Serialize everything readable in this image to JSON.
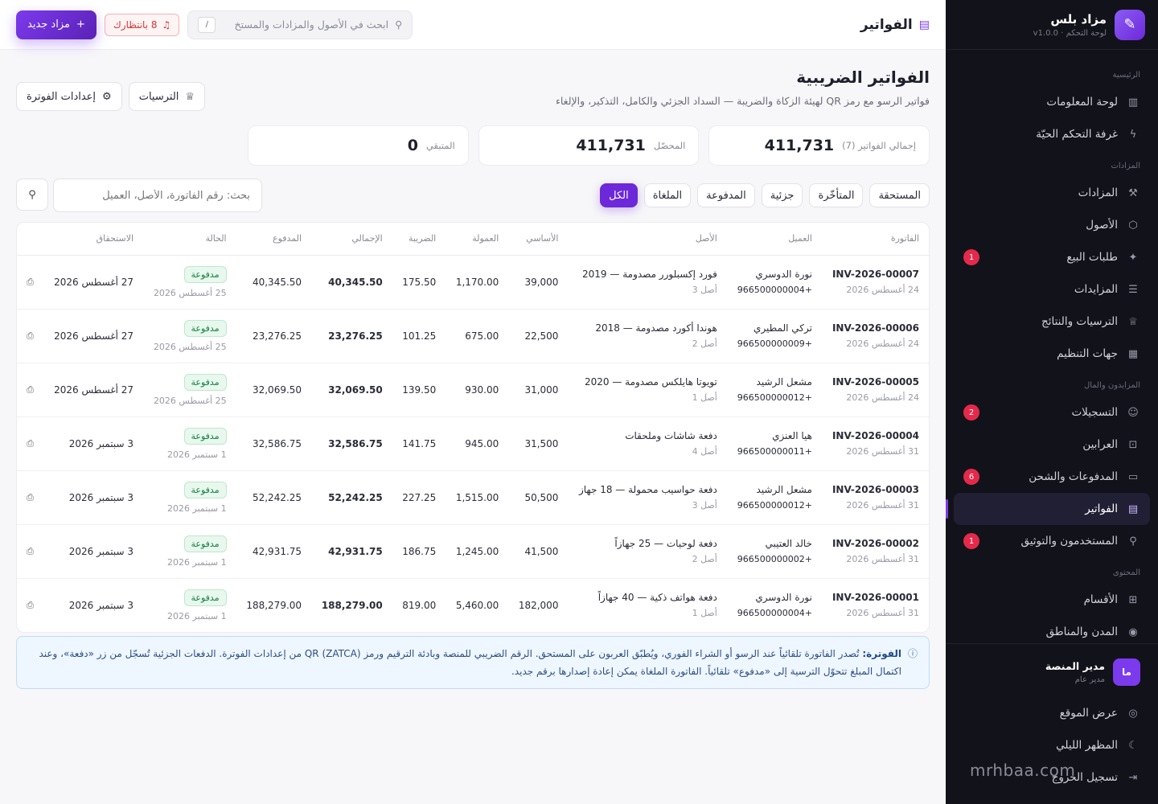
{
  "brand": {
    "name": "مزاد بلس",
    "sub": "لوحة التحكم · v1.0.0"
  },
  "nav": [
    {
      "type": "section",
      "label": "الرئيسية"
    },
    {
      "type": "item",
      "key": "info-panel",
      "label": "لوحة المعلومات",
      "icon": "chart-icon",
      "glyph": "▥"
    },
    {
      "type": "item",
      "key": "live-room",
      "label": "غرفة التحكم الحيّة",
      "icon": "bolt-icon",
      "glyph": "ϟ"
    },
    {
      "type": "section",
      "label": "المزادات"
    },
    {
      "type": "item",
      "key": "auctions",
      "label": "المزادات",
      "icon": "gavel-icon",
      "glyph": "⚒"
    },
    {
      "type": "item",
      "key": "assets",
      "label": "الأصول",
      "icon": "cube-icon",
      "glyph": "⬡"
    },
    {
      "type": "item",
      "key": "sell-requests",
      "label": "طلبات البيع",
      "icon": "sparkle-icon",
      "glyph": "✦",
      "badge": "1"
    },
    {
      "type": "item",
      "key": "bids",
      "label": "المزايدات",
      "icon": "list-icon",
      "glyph": "☰"
    },
    {
      "type": "item",
      "key": "awards",
      "label": "الترسيات والنتائج",
      "icon": "trophy-icon",
      "glyph": "♕"
    },
    {
      "type": "item",
      "key": "orgs",
      "label": "جهات التنظيم",
      "icon": "building-icon",
      "glyph": "▦"
    },
    {
      "type": "section",
      "label": "المزايدون والمال"
    },
    {
      "type": "item",
      "key": "registrations",
      "label": "التسجيلات",
      "icon": "user-icon",
      "glyph": "☺",
      "badge": "2"
    },
    {
      "type": "item",
      "key": "deposits",
      "label": "العرابين",
      "icon": "lock-icon",
      "glyph": "⊡"
    },
    {
      "type": "item",
      "key": "payments",
      "label": "المدفوعات والشحن",
      "icon": "card-icon",
      "glyph": "▭",
      "badge": "6"
    },
    {
      "type": "item",
      "key": "invoices",
      "label": "الفواتير",
      "icon": "invoice-icon",
      "glyph": "▤",
      "active": true
    },
    {
      "type": "item",
      "key": "users",
      "label": "المستخدمون والتوثيق",
      "icon": "person-icon",
      "glyph": "⚲",
      "badge": "1"
    },
    {
      "type": "section",
      "label": "المحتوى"
    },
    {
      "type": "item",
      "key": "categories",
      "label": "الأقسام",
      "icon": "grid-icon",
      "glyph": "⊞"
    },
    {
      "type": "item",
      "key": "cities",
      "label": "المدن والمناطق",
      "icon": "pin-icon",
      "glyph": "◉"
    }
  ],
  "user": {
    "avatar": "ما",
    "name": "مدير المنصة",
    "role": "مدير عام"
  },
  "bottom_nav": [
    {
      "key": "view-site",
      "label": "عرض الموقع",
      "icon": "eye-icon",
      "glyph": "◎"
    },
    {
      "key": "dark-mode",
      "label": "المظهر الليلي",
      "icon": "moon-icon",
      "glyph": "☾"
    },
    {
      "key": "logout",
      "label": "تسجيل الخروج",
      "icon": "logout-icon",
      "glyph": "⇥"
    }
  ],
  "watermark": "mrhbaa.com",
  "topbar": {
    "title": "الفواتير",
    "search_placeholder": "ابحث في الأصول والمزادات والمستخ",
    "kbd": "/",
    "pending_label": "8 بانتظارك",
    "new_label": "مزاد جديد"
  },
  "page": {
    "title": "الفواتير الضريبية",
    "subtitle": "فواتير الرسو مع رمز QR لهيئة الزكاة والضريبة — السداد الجزئي والكامل، التذكير، والإلغاء",
    "btn_awards": "الترسيات",
    "btn_settings": "إعدادات الفوترة"
  },
  "stats": [
    {
      "key": "total",
      "label": "إجمالي الفواتير (7)",
      "value": "411,731"
    },
    {
      "key": "collected",
      "label": "المحصّل",
      "value": "411,731"
    },
    {
      "key": "remaining",
      "label": "المتبقي",
      "value": "0"
    }
  ],
  "filters": {
    "chips": [
      {
        "key": "due",
        "label": "المستحقة"
      },
      {
        "key": "late",
        "label": "المتأخّرة"
      },
      {
        "key": "partial",
        "label": "جزئية"
      },
      {
        "key": "paid",
        "label": "المدفوعة"
      },
      {
        "key": "cancelled",
        "label": "الملغاة"
      },
      {
        "key": "all",
        "label": "الكل",
        "active": true
      }
    ],
    "search_placeholder": "بحث: رقم الفاتورة، الأصل، العميل"
  },
  "table": {
    "headers": [
      "الفاتورة",
      "العميل",
      "الأصل",
      "الأساسي",
      "العمولة",
      "الضريبة",
      "الإجمالي",
      "المدفوع",
      "الحالة",
      "الاستحقاق",
      ""
    ],
    "rows": [
      {
        "inv": "INV-2026-00007",
        "inv_date": "24 أغسطس 2026",
        "client": "نورة الدوسري",
        "phone": "+966500000004",
        "asset": "فورد إكسبلورر مصدومة — 2019",
        "asset_sub": "أصل 3",
        "base": "39,000",
        "commission": "1,170.00",
        "tax": "175.50",
        "total": "40,345.50",
        "paid": "40,345.50",
        "status": "مدفوعة",
        "status_date": "25 أغسطس 2026",
        "due": "27 أغسطس 2026"
      },
      {
        "inv": "INV-2026-00006",
        "inv_date": "24 أغسطس 2026",
        "client": "تركي المطيري",
        "phone": "+966500000009",
        "asset": "هوندا أكورد مصدومة — 2018",
        "asset_sub": "أصل 2",
        "base": "22,500",
        "commission": "675.00",
        "tax": "101.25",
        "total": "23,276.25",
        "paid": "23,276.25",
        "status": "مدفوعة",
        "status_date": "25 أغسطس 2026",
        "due": "27 أغسطس 2026"
      },
      {
        "inv": "INV-2026-00005",
        "inv_date": "24 أغسطس 2026",
        "client": "مشعل الرشيد",
        "phone": "+966500000012",
        "asset": "تويوتا هايلكس مصدومة — 2020",
        "asset_sub": "أصل 1",
        "base": "31,000",
        "commission": "930.00",
        "tax": "139.50",
        "total": "32,069.50",
        "paid": "32,069.50",
        "status": "مدفوعة",
        "status_date": "25 أغسطس 2026",
        "due": "27 أغسطس 2026"
      },
      {
        "inv": "INV-2026-00004",
        "inv_date": "31 أغسطس 2026",
        "client": "هيا العنزي",
        "phone": "+966500000011",
        "asset": "دفعة شاشات وملحقات",
        "asset_sub": "أصل 4",
        "base": "31,500",
        "commission": "945.00",
        "tax": "141.75",
        "total": "32,586.75",
        "paid": "32,586.75",
        "status": "مدفوعة",
        "status_date": "1 سبتمبر 2026",
        "due": "3 سبتمبر 2026"
      },
      {
        "inv": "INV-2026-00003",
        "inv_date": "31 أغسطس 2026",
        "client": "مشعل الرشيد",
        "phone": "+966500000012",
        "asset": "دفعة حواسيب محمولة — 18 جهاز",
        "asset_sub": "أصل 3",
        "base": "50,500",
        "commission": "1,515.00",
        "tax": "227.25",
        "total": "52,242.25",
        "paid": "52,242.25",
        "status": "مدفوعة",
        "status_date": "1 سبتمبر 2026",
        "due": "3 سبتمبر 2026"
      },
      {
        "inv": "INV-2026-00002",
        "inv_date": "31 أغسطس 2026",
        "client": "خالد العتيبي",
        "phone": "+966500000002",
        "asset": "دفعة لوحيات — 25 جهازاً",
        "asset_sub": "أصل 2",
        "base": "41,500",
        "commission": "1,245.00",
        "tax": "186.75",
        "total": "42,931.75",
        "paid": "42,931.75",
        "status": "مدفوعة",
        "status_date": "1 سبتمبر 2026",
        "due": "3 سبتمبر 2026"
      },
      {
        "inv": "INV-2026-00001",
        "inv_date": "31 أغسطس 2026",
        "client": "نورة الدوسري",
        "phone": "+966500000004",
        "asset": "دفعة هواتف ذكية — 40 جهازاً",
        "asset_sub": "أصل 1",
        "base": "182,000",
        "commission": "5,460.00",
        "tax": "819.00",
        "total": "188,279.00",
        "paid": "188,279.00",
        "status": "مدفوعة",
        "status_date": "1 سبتمبر 2026",
        "due": "3 سبتمبر 2026"
      }
    ]
  },
  "info": {
    "title": "الفوترة:",
    "text": "تُصدر الفاتورة تلقائياً عند الرسو أو الشراء الفوري، ويُطبّق العربون على المستحق. الرقم الضريبي للمنصة وبادئة الترقيم ورمز QR (ZATCA) من إعدادات الفوترة. الدفعات الجزئية تُسجّل من زر «دفعة»، وعند اكتمال المبلغ تتحوّل الترسية إلى «مدفوع» تلقائياً. الفاتورة الملغاة يمكن إعادة إصدارها برقم جديد."
  },
  "colors": {
    "accent": "#7c3aed",
    "sidebar": "#12121a",
    "paid_green": "#15803d",
    "badge_red": "#e5294b"
  }
}
